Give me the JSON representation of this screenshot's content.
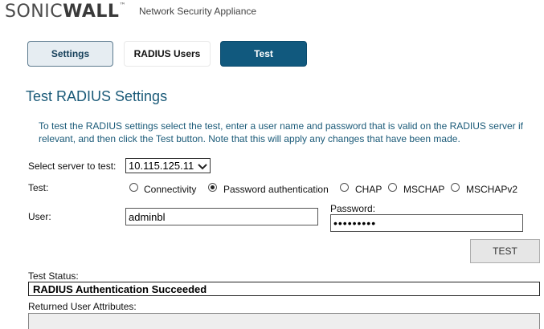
{
  "header": {
    "logo_text_light": "SONIC",
    "logo_text_bold": "WALL",
    "logo_tm": "™",
    "subtitle": "Network Security Appliance"
  },
  "tabs": [
    {
      "label": "Settings",
      "state": "normal"
    },
    {
      "label": "RADIUS Users",
      "state": "normal"
    },
    {
      "label": "Test",
      "state": "active"
    }
  ],
  "page_title": "Test RADIUS Settings",
  "info_text": "To test the RADIUS settings select the test, enter a user name and password that is valid on the RADIUS server if relevant, and then click the Test button. Note that this will apply any changes that have been made.",
  "form": {
    "server_label": "Select server to test:",
    "server_value": "10.115.125.11",
    "test_label": "Test:",
    "test_options": [
      {
        "label": "Connectivity",
        "selected": false
      },
      {
        "label": "Password authentication",
        "selected": true
      },
      {
        "label": "CHAP",
        "selected": false
      },
      {
        "label": "MSCHAP",
        "selected": false
      },
      {
        "label": "MSCHAPv2",
        "selected": false
      }
    ],
    "user_label": "User:",
    "user_value": "adminbl",
    "password_label": "Password:",
    "password_value": "•••••••••",
    "test_button": "TEST",
    "status_label": "Test Status:",
    "status_value": "RADIUS Authentication Succeeded",
    "returned_label": "Returned User Attributes:"
  },
  "colors": {
    "accent": "#11597e",
    "title": "#1a5a78"
  }
}
